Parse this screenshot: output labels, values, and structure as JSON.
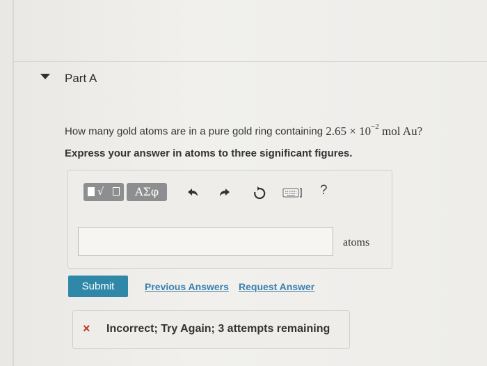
{
  "part": {
    "title": "Part A"
  },
  "question": {
    "prefix": "How many gold atoms are in a pure gold ring containing ",
    "coefficient": "2.65",
    "times": "×",
    "base": "10",
    "exponent": "−2",
    "unit": "mol Au?",
    "instruction": "Express your answer in atoms to three significant figures."
  },
  "toolbar": {
    "greek_label": "ΑΣφ",
    "help_label": "?"
  },
  "answer": {
    "value": "",
    "units": "atoms"
  },
  "actions": {
    "submit_label": "Submit",
    "previous_answers_label": "Previous Answers",
    "request_answer_label": "Request Answer"
  },
  "feedback": {
    "icon": "×",
    "message": "Incorrect; Try Again; 3 attempts remaining",
    "status_color": "#c0392b"
  },
  "colors": {
    "accent": "#2f88a8",
    "link": "#3b7fae"
  }
}
